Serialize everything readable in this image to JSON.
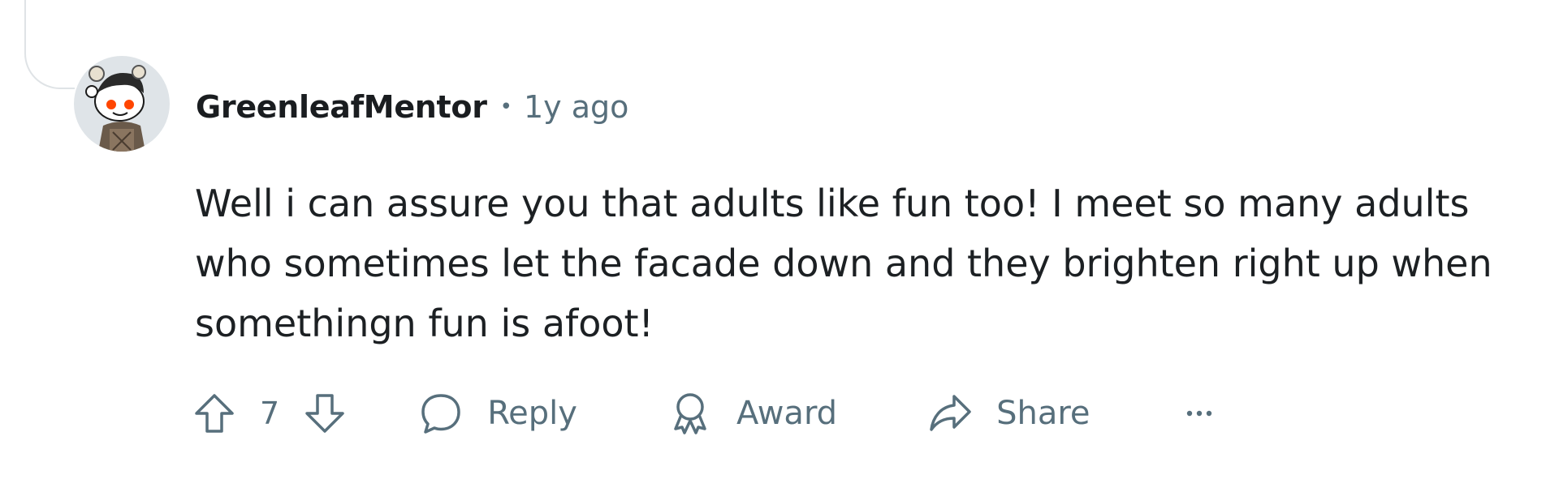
{
  "comment": {
    "author": "GreenleafMentor",
    "separator": "•",
    "timestamp": "1y ago",
    "body": "Well i can assure you that adults like fun too! I meet so many adults who sometimes let the facade down and they brighten right up when somethingn fun is afoot!",
    "avatar_icon": "snoo-avatar"
  },
  "actions": {
    "upvote_icon": "arrow-up-icon",
    "vote_count": "7",
    "downvote_icon": "arrow-down-icon",
    "reply_label": "Reply",
    "award_label": "Award",
    "share_label": "Share",
    "more_icon": "ellipsis-icon"
  },
  "colors": {
    "text_primary": "#1c2023",
    "text_secondary": "#576f7c",
    "thread_line": "#dfe3e6",
    "avatar_bg": "#dfe4e8",
    "snoo_eyes": "#ff4500"
  }
}
